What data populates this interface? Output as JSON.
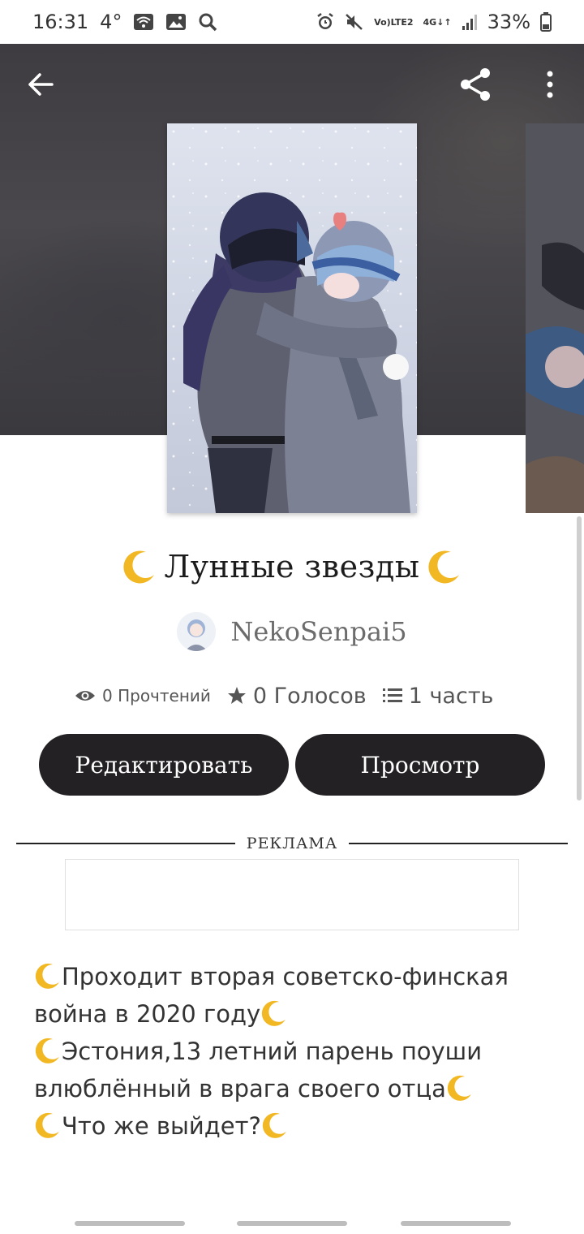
{
  "status_bar": {
    "time": "16:31",
    "temp": "4°",
    "network_top": "Vo)",
    "network_bottom": "LTE2",
    "net_4g_top": "4G",
    "net_4g_bottom": "↓↑",
    "battery": "33%"
  },
  "header": {
    "back_icon": "arrow-left-icon",
    "share_icon": "share-icon",
    "more_icon": "more-vertical-icon"
  },
  "story": {
    "title": "Лунные звезды",
    "author": "NekoSenpai5",
    "reads": "0 Прочтений",
    "votes": "0 Голосов",
    "parts": "1 часть"
  },
  "buttons": {
    "edit": "Редактировать",
    "view": "Просмотр"
  },
  "ad": {
    "label": "РЕКЛАМА"
  },
  "description": {
    "line1": "Проходит вторая советско-финская",
    "line2": "война в 2020 году",
    "line3": "Эстония,13 летний парень поуши",
    "line4": "влюблённый в врага своего отца",
    "line5": "Что же выйдет?"
  },
  "colors": {
    "button_bg": "#232123",
    "moon": "#f2b824",
    "header_bg": "#444247"
  }
}
